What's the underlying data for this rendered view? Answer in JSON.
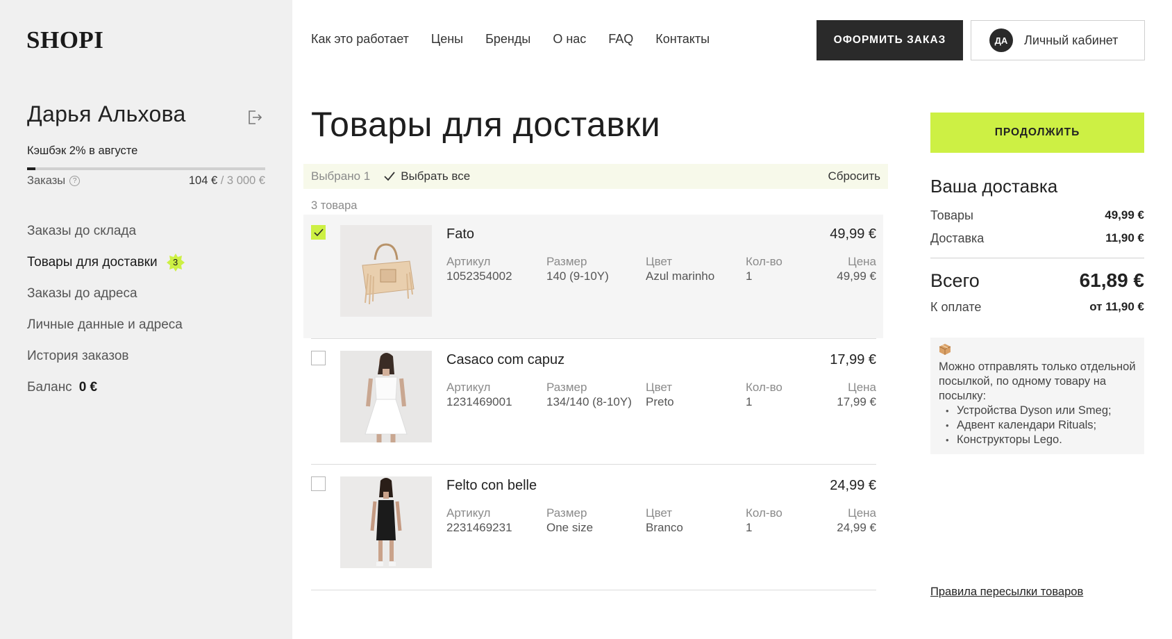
{
  "app": {
    "logo": "SHOPI"
  },
  "header": {
    "nav": [
      "Как это работает",
      "Цены",
      "Бренды",
      "О нас",
      "FAQ",
      "Контакты"
    ],
    "order_button": "ОФОРМИТЬ ЗАКАЗ",
    "cabinet": {
      "initials": "ДА",
      "label": "Личный кабинет"
    }
  },
  "sidebar": {
    "user_name": "Дарья Альхова",
    "cashback": "Кэшбэк 2% в августе",
    "progress_fraction": 0.035,
    "orders_label": "Заказы",
    "orders_amount": "104 €",
    "orders_limit": "/ 3 000 €",
    "items": [
      {
        "label": "Заказы до склада"
      },
      {
        "label": "Товары для доставки",
        "badge": "3",
        "active": true
      },
      {
        "label": "Заказы до адреса"
      },
      {
        "label": "Личные данные и адреса"
      },
      {
        "label": "История заказов"
      },
      {
        "label": "Баланс",
        "value": "0 €"
      }
    ],
    "accent_color": "#cdf044"
  },
  "main": {
    "title": "Товары для доставки",
    "selection": {
      "count_label": "Выбрано 1",
      "select_all": "Выбрать все",
      "reset": "Сбросить"
    },
    "items_count": "3 товара",
    "columns": {
      "sku": "Артикул",
      "size": "Размер",
      "color": "Цвет",
      "qty": "Кол-во",
      "price": "Цена"
    },
    "items": [
      {
        "name": "Fato",
        "price": "49,99 €",
        "sku": "1052354002",
        "size": "140 (9-10Y)",
        "color": "Azul marinho",
        "qty": "1",
        "unit_price": "49,99 €",
        "checked": true,
        "image": "bag"
      },
      {
        "name": "Casaco com capuz",
        "price": "17,99 €",
        "sku": "1231469001",
        "size": "134/140 (8-10Y)",
        "color": "Preto",
        "qty": "1",
        "unit_price": "17,99 €",
        "checked": false,
        "image": "white-dress"
      },
      {
        "name": "Felto con belle",
        "price": "24,99 €",
        "sku": "2231469231",
        "size": "One size",
        "color": "Branco",
        "qty": "1",
        "unit_price": "24,99 €",
        "checked": false,
        "image": "black-dress"
      }
    ]
  },
  "summary": {
    "continue_button": "ПРОДОЛЖИТЬ",
    "title": "Ваша доставка",
    "goods_label": "Товары",
    "goods_value": "49,99 €",
    "delivery_label": "Доставка",
    "delivery_value": "11,90 €",
    "total_label": "Всего",
    "total_value": "61,89 €",
    "pay_label": "К оплате",
    "pay_value": "от 11,90 €",
    "note": {
      "icon": "package-icon",
      "text": "Можно отправлять только отдельной посылкой, по одному товару на посылку:",
      "items": [
        "Устройства Dyson или Smeg;",
        "Адвент календари Rituals;",
        "Конструкторы Lego."
      ]
    },
    "rules_link": "Правила пересылки товаров"
  }
}
